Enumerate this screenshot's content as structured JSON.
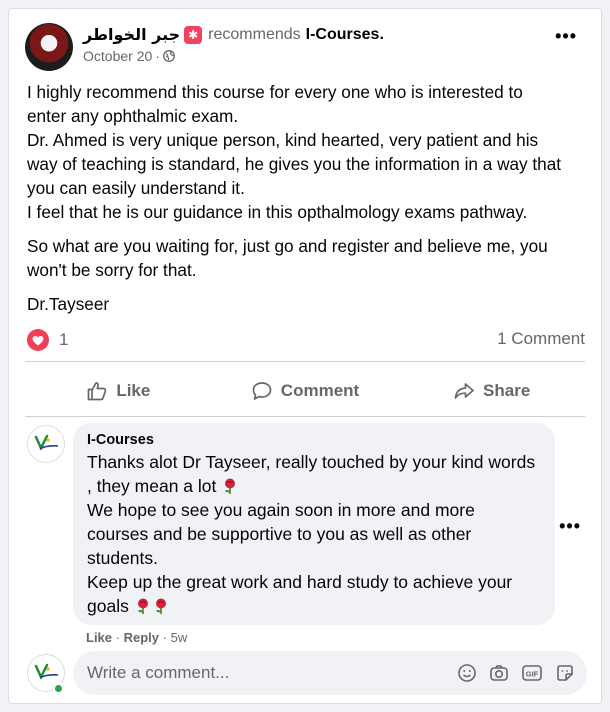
{
  "post": {
    "author": "جبر الخواطر",
    "recommends_text": "recommends",
    "page_name": "I-Courses.",
    "date": "October 20",
    "separator": "·",
    "body_lines": [
      "I highly recommend this course for every one who is interested to",
      "enter any ophthalmic exam.",
      "Dr. Ahmed is very unique person, kind hearted, very patient and his",
      "way of teaching is standard, he gives you the information in a way that",
      "you can easily understand it.",
      "I feel that he is our guidance in this opthalmology exams pathway."
    ],
    "body_para2_lines": [
      "So what are you waiting for, just go and register and believe me, you",
      "won't be sorry for that."
    ],
    "signature": "Dr.Tayseer",
    "more_icon": "•••"
  },
  "reactions": {
    "count": "1",
    "comments": "1 Comment",
    "reaction_icon": "heart-icon",
    "heart_color": "#f33e58"
  },
  "actions": {
    "like": "Like",
    "comment": "Comment",
    "share": "Share"
  },
  "comment": {
    "author": "I-Courses",
    "lines": [
      "Thanks alot Dr Tayseer, really touched by your kind words",
      ", they mean a lot",
      "We hope to see you again soon in more and more",
      "courses and be supportive to you as well as other",
      "students.",
      "Keep up the great work and hard study to achieve your",
      "goals"
    ],
    "like": "Like",
    "reply": "Reply",
    "time": "5w",
    "separator": "·",
    "more_icon": "•••"
  },
  "composer": {
    "placeholder": "Write a comment...",
    "icons": [
      "emoji-icon",
      "camera-icon",
      "gif-icon",
      "sticker-icon"
    ],
    "gif_label": "GIF"
  },
  "colors": {
    "recommend_badge": "#f3425f",
    "online": "#31a24c",
    "muted_text": "#65676b"
  }
}
